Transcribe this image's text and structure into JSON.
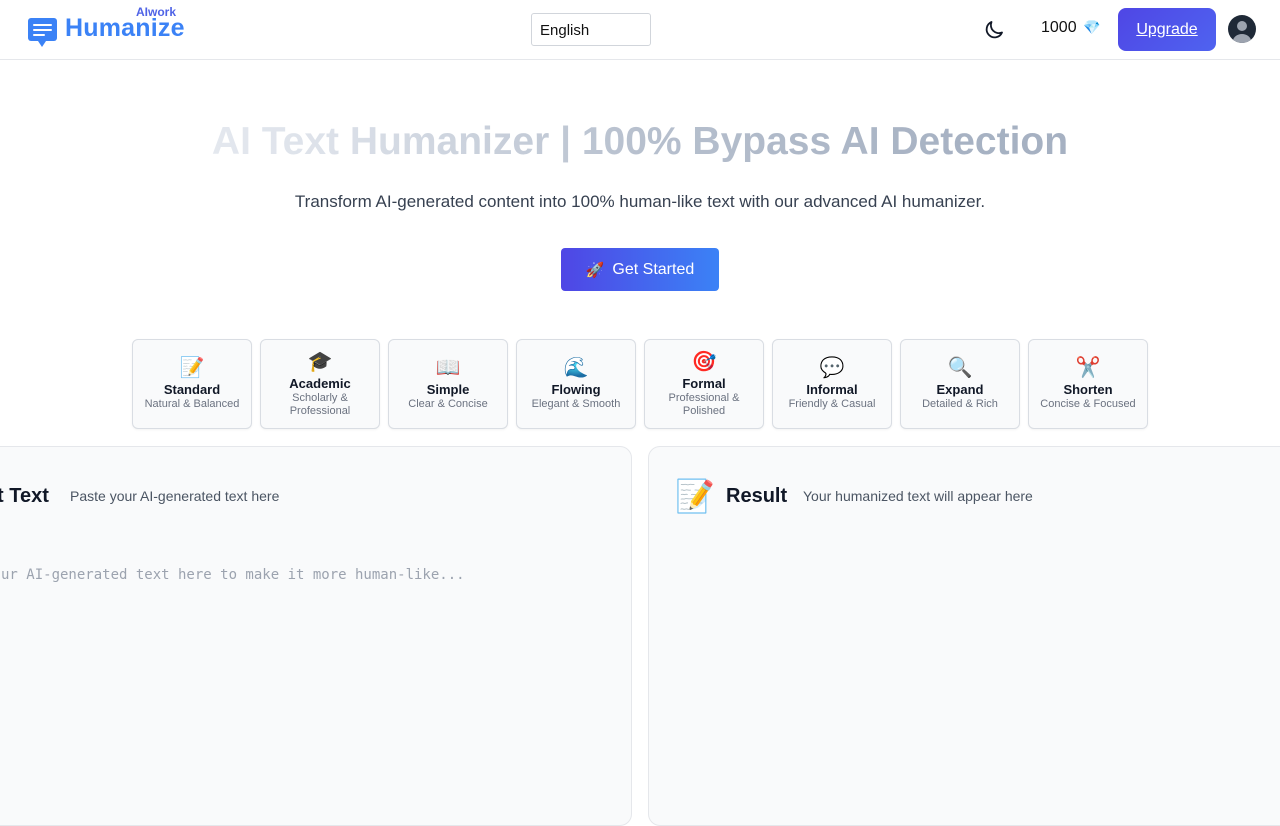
{
  "header": {
    "brand_small": "AIwork",
    "brand_name": "Humanize",
    "language": "English",
    "credits": "1000",
    "credits_icon": "💎",
    "upgrade_label": "Upgrade",
    "icons": {
      "logo": "chat-bubble-icon",
      "theme": "moon-icon",
      "avatar": "user-avatar-icon"
    }
  },
  "hero": {
    "title": "AI Text Humanizer | 100% Bypass AI Detection",
    "subtitle": "Transform AI-generated content into 100% human-like text with our advanced AI humanizer.",
    "cta_icon": "🚀",
    "cta_label": "Get Started"
  },
  "modes": [
    {
      "emoji": "📝",
      "title": "Standard",
      "desc": "Natural & Balanced"
    },
    {
      "emoji": "🎓",
      "title": "Academic",
      "desc": "Scholarly & Professional"
    },
    {
      "emoji": "📖",
      "title": "Simple",
      "desc": "Clear & Concise"
    },
    {
      "emoji": "🌊",
      "title": "Flowing",
      "desc": "Elegant & Smooth"
    },
    {
      "emoji": "🎯",
      "title": "Formal",
      "desc": "Professional & Polished"
    },
    {
      "emoji": "💬",
      "title": "Informal",
      "desc": "Friendly & Casual"
    },
    {
      "emoji": "🔍",
      "title": "Expand",
      "desc": "Detailed & Rich"
    },
    {
      "emoji": "✂️",
      "title": "Shorten",
      "desc": "Concise & Focused"
    }
  ],
  "input_panel": {
    "title": "t Text",
    "hint": "Paste your AI-generated text here",
    "placeholder": "ur AI-generated text here to make it more human-like..."
  },
  "result_panel": {
    "emoji": "📝",
    "title": "Result",
    "hint": "Your humanized text will appear here"
  },
  "colors": {
    "accent": "#4f46e5",
    "brand": "#3b82f6"
  }
}
